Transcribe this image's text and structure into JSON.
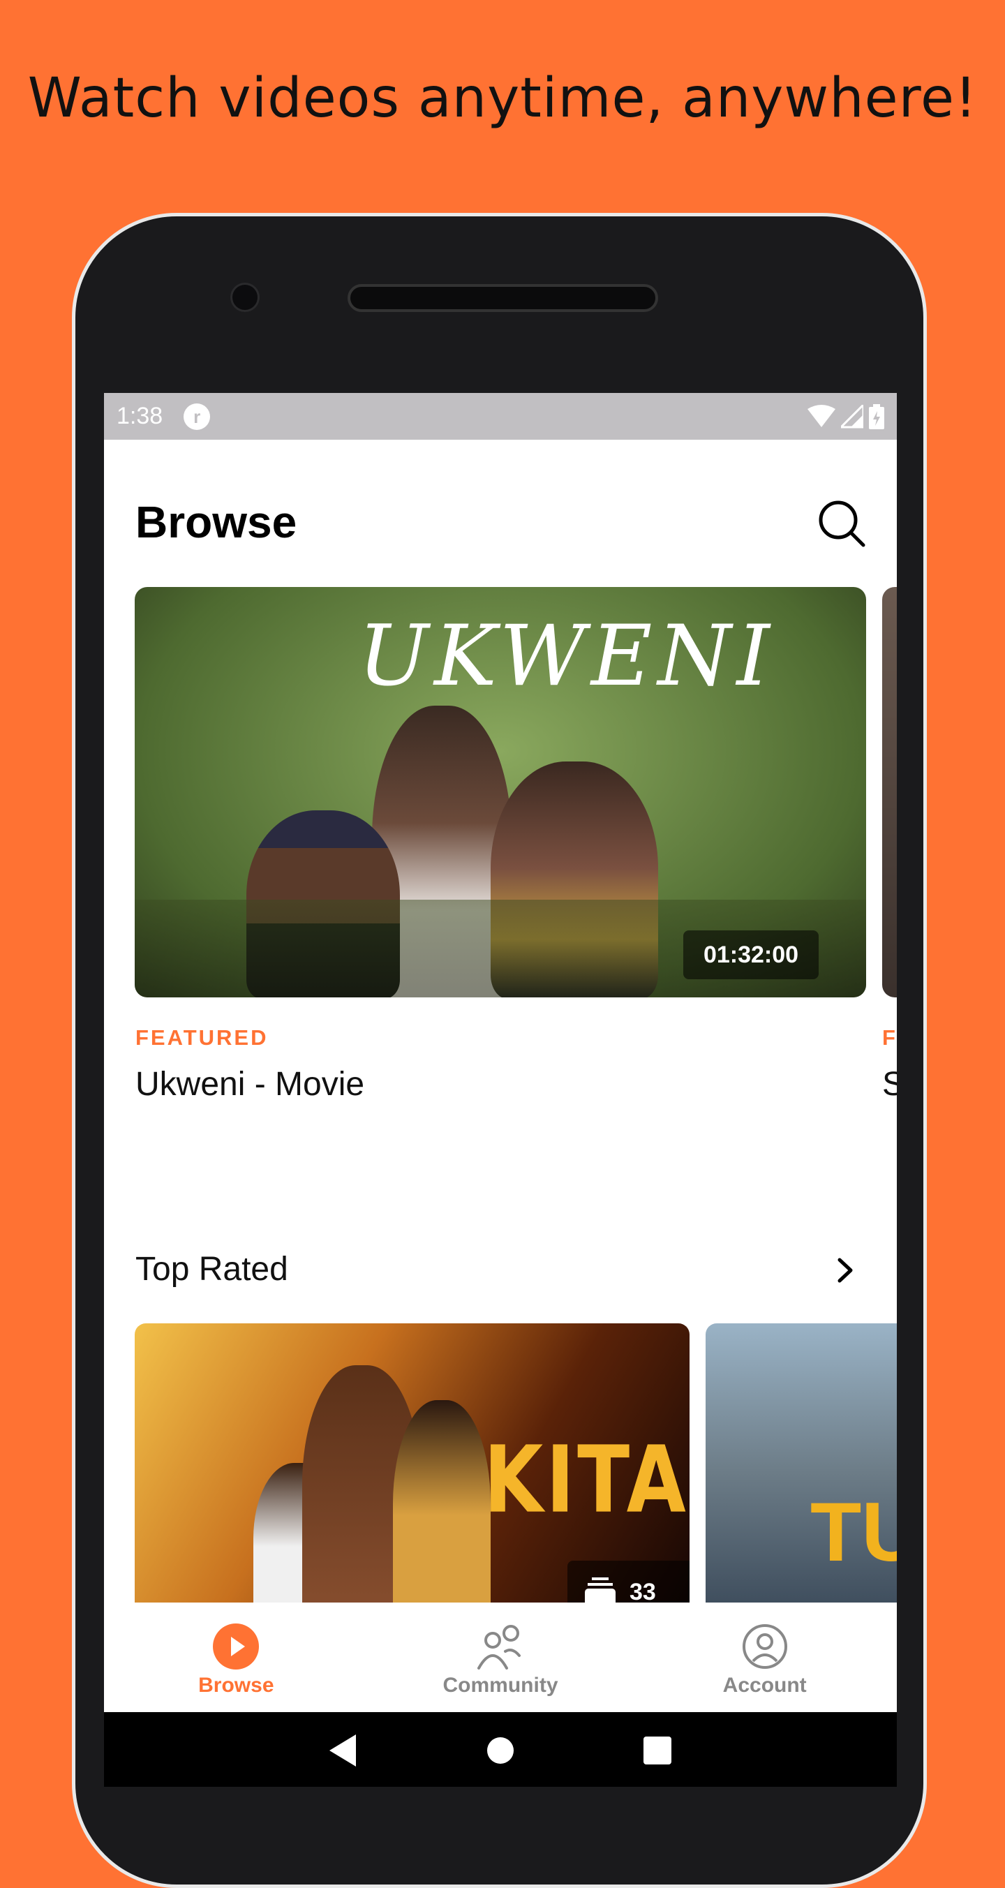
{
  "headline": "Watch videos anytime, anywhere!",
  "status": {
    "time": "1:38",
    "notification_icon": "circle-app-icon",
    "icons": [
      "wifi-icon",
      "signal-icon",
      "battery-charging-icon"
    ]
  },
  "header": {
    "title": "Browse",
    "search_icon": "search-icon"
  },
  "featured": {
    "items": [
      {
        "label": "FEATURED",
        "title": "Ukweni - Movie",
        "poster_text": "UKWENI",
        "duration": "01:32:00"
      },
      {
        "label": "F",
        "title": "S"
      }
    ]
  },
  "top_rated": {
    "title": "Top Rated",
    "cards": [
      {
        "poster_text": "KITASA",
        "count": "33"
      },
      {
        "poster_text": "TU"
      }
    ]
  },
  "bottom_nav": [
    {
      "label": "Browse",
      "icon": "play-circle-icon",
      "active": true
    },
    {
      "label": "Community",
      "icon": "people-icon",
      "active": false
    },
    {
      "label": "Account",
      "icon": "user-circle-icon",
      "active": false
    }
  ],
  "colors": {
    "accent": "#FF7233",
    "background": "#FF7233",
    "inactive": "#888888"
  }
}
